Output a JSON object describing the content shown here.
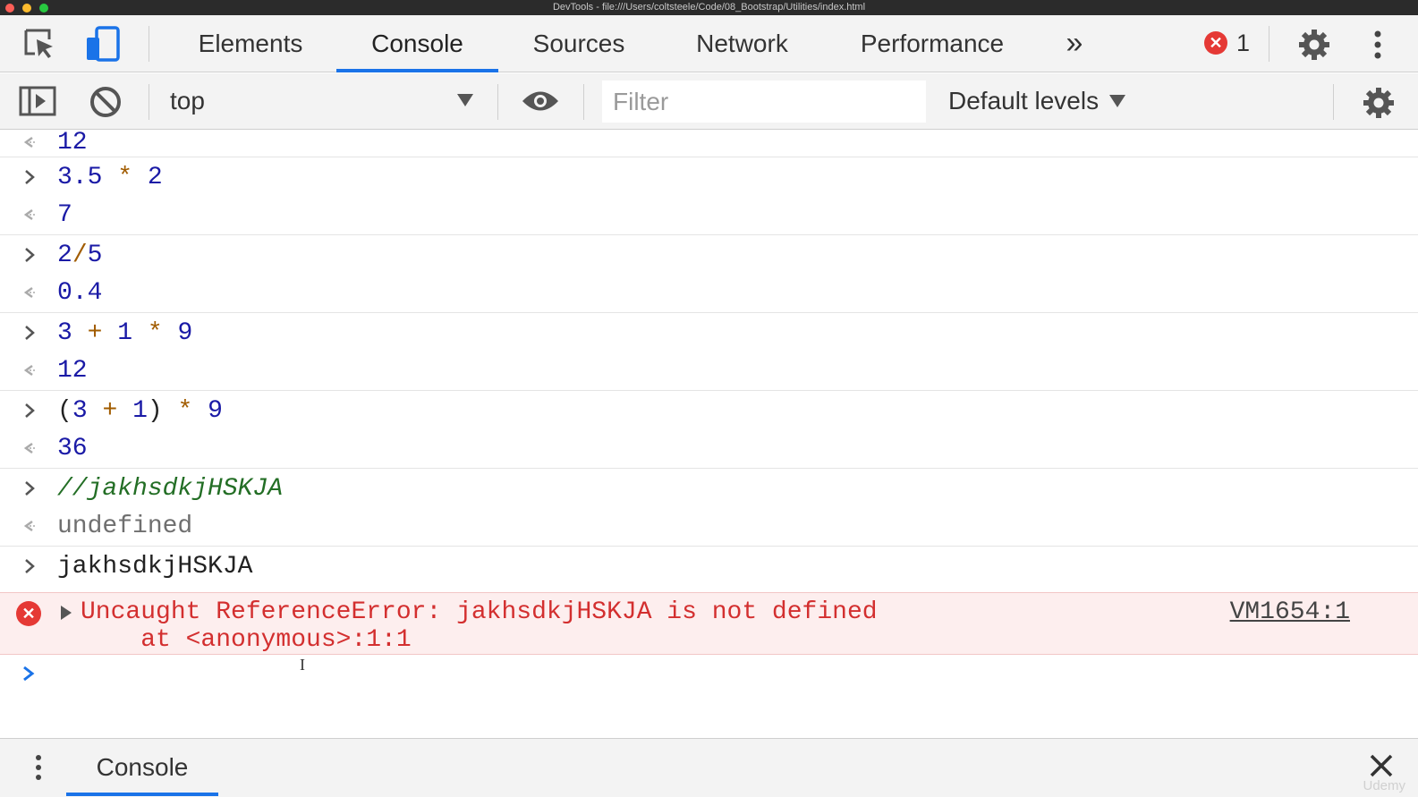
{
  "window": {
    "title": "DevTools - file:///Users/coltsteele/Code/08_Bootstrap/Utilities/index.html"
  },
  "toolbar": {
    "tabs": [
      "Elements",
      "Console",
      "Sources",
      "Network",
      "Performance"
    ],
    "active_tab": "Console",
    "more_tabs_glyph": "»",
    "error_count": "1"
  },
  "console_toolbar": {
    "context": "top",
    "filter_placeholder": "Filter",
    "levels": "Default levels"
  },
  "log": {
    "top_result": "12",
    "entries": [
      {
        "input": "3.5 * 2",
        "result": "7"
      },
      {
        "input": "2/5",
        "result": "0.4"
      },
      {
        "input": "3 + 1 * 9",
        "result": "12"
      },
      {
        "input": "(3 + 1) * 9",
        "result": "36"
      },
      {
        "input": "//jakhsdkjHSKJA",
        "result": "undefined"
      },
      {
        "input": "jakhsdkjHSKJA"
      }
    ],
    "error": {
      "message": "Uncaught ReferenceError: jakhsdkjHSKJA is not defined",
      "stack": "    at <anonymous>:1:1",
      "source": "VM1654:1"
    }
  },
  "drawer": {
    "tab": "Console"
  },
  "watermark": "Udemy",
  "colors": {
    "accent": "#1a73e8",
    "error": "#d32f2f",
    "error_bg": "#fdeeee",
    "number": "#1a1aa6",
    "operator": "#a15c00",
    "comment": "#236e25"
  },
  "icons": {
    "inspect": "inspect-element-icon",
    "device": "device-toolbar-icon",
    "settings": "gear-icon",
    "kebab": "kebab-menu-icon",
    "sidebar": "sidebar-toggle-icon",
    "clear": "clear-console-icon",
    "eye": "live-expression-eye-icon",
    "close": "close-icon"
  }
}
